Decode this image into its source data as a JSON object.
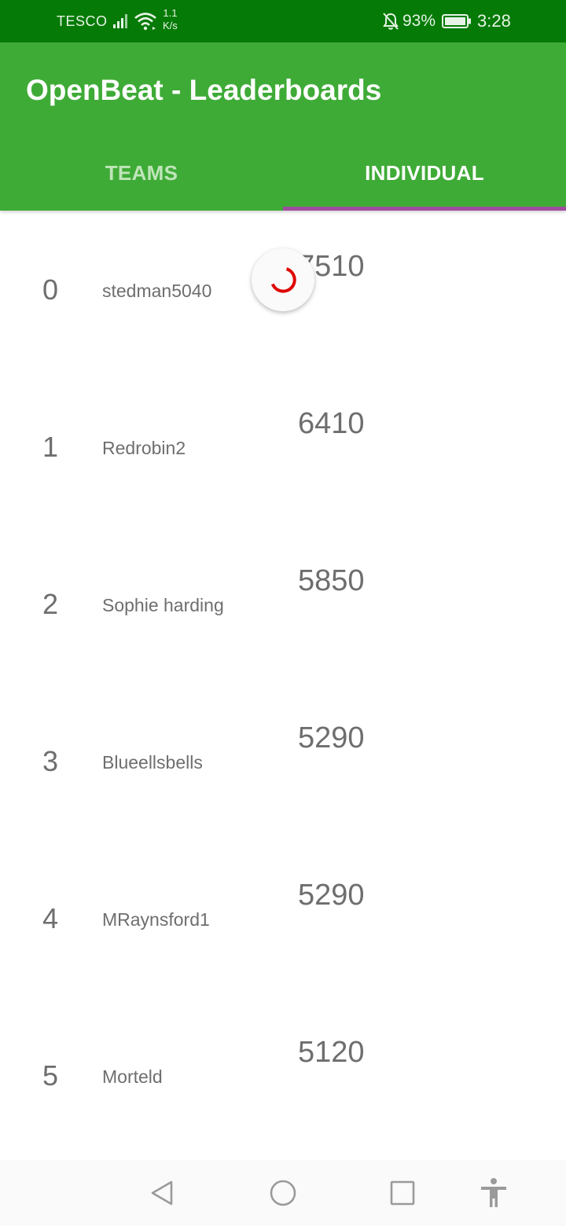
{
  "status_bar": {
    "carrier": "TESCO",
    "speed_value": "1.1",
    "speed_unit": "K/s",
    "battery_percent": "93%",
    "time": "3:28",
    "icons": [
      "signal-icon",
      "wifi-icon",
      "bell-off-icon",
      "battery-icon"
    ]
  },
  "app_bar": {
    "title": "OpenBeat - Leaderboards",
    "background_color": "#3fab37",
    "tabs": [
      {
        "label": "TEAMS",
        "selected": false
      },
      {
        "label": "INDIVIDUAL",
        "selected": true
      }
    ],
    "indicator_color": "#a04aa0"
  },
  "leaderboard": {
    "rows": [
      {
        "rank": "0",
        "name": "stedman5040",
        "score": "7510"
      },
      {
        "rank": "1",
        "name": "Redrobin2",
        "score": "6410"
      },
      {
        "rank": "2",
        "name": "Sophie harding",
        "score": "5850"
      },
      {
        "rank": "3",
        "name": "Blueellsbells",
        "score": "5290"
      },
      {
        "rank": "4",
        "name": "MRaynsford1",
        "score": "5290"
      },
      {
        "rank": "5",
        "name": "Morteld",
        "score": "5120"
      }
    ]
  },
  "refresh_indicator": {
    "icon": "refresh-spinner-icon",
    "color": "#e00000"
  },
  "nav_bar": {
    "icons": [
      "back-icon",
      "home-icon",
      "recent-apps-icon",
      "accessibility-icon"
    ]
  }
}
